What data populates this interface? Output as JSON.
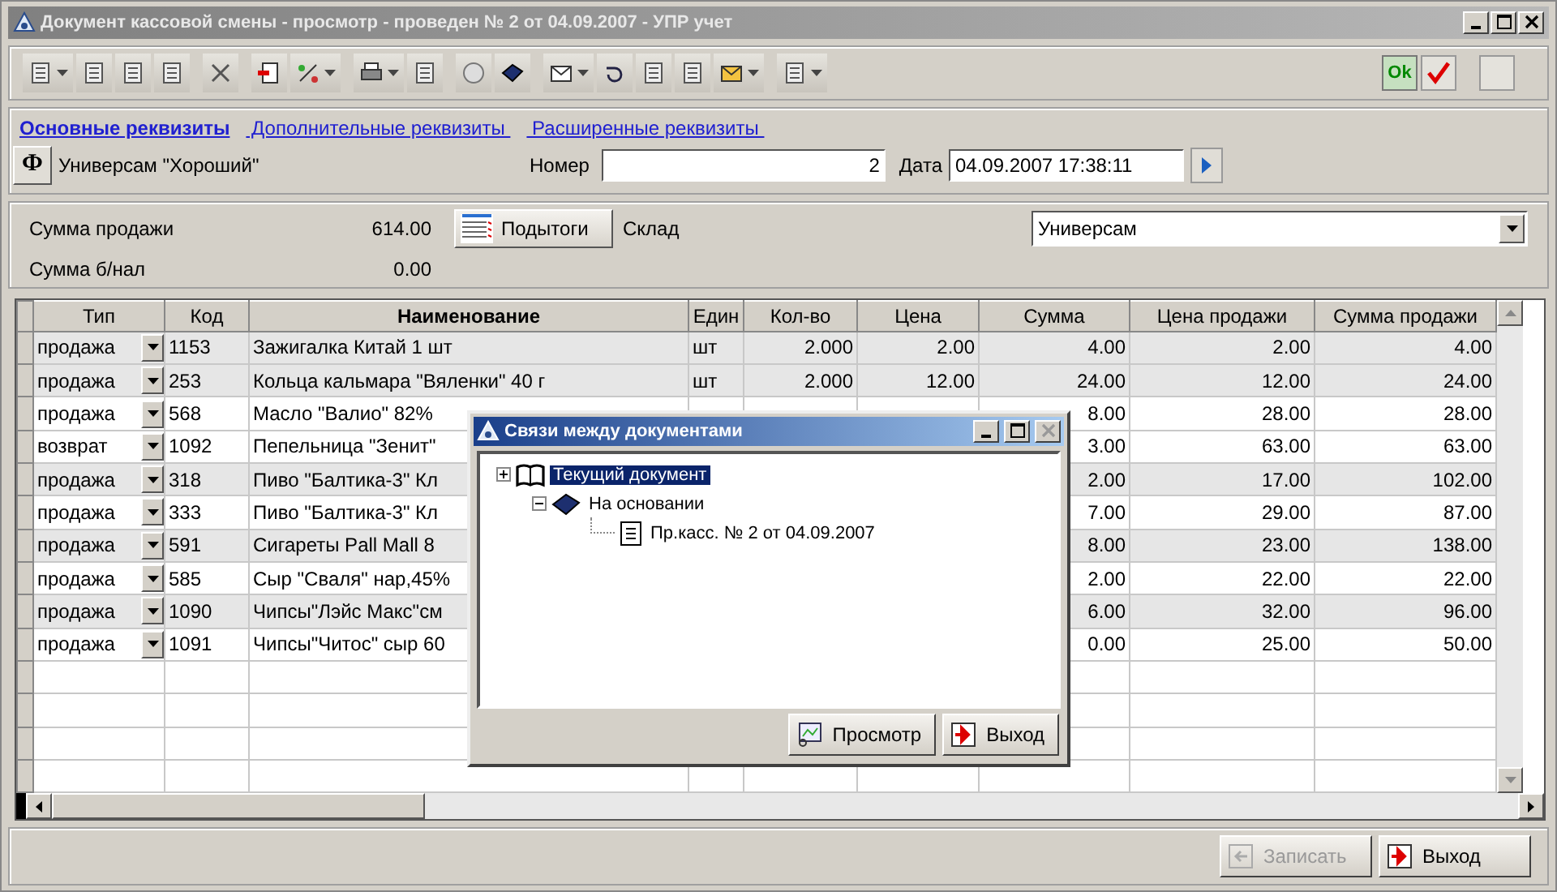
{
  "window": {
    "title": "Документ кассовой смены  - просмотр - проведен № 2 от 04.09.2007 - УПР учет"
  },
  "toolbar_right": {
    "ok_label": "Ok"
  },
  "tabs": [
    {
      "label": "Основные реквизиты",
      "selected": true
    },
    {
      "label": " Дополнительные реквизиты ",
      "selected": false
    },
    {
      "label": " Расширенные реквизиты ",
      "selected": false
    }
  ],
  "header": {
    "firm_button": "Ф",
    "firm_name": "Универсам \"Хороший\"",
    "number_label": "Номер",
    "number": "2",
    "date_label": "Дата",
    "date": "04.09.2007 17:38:11"
  },
  "summary": {
    "sale_label": "Сумма продажи",
    "sale_value": "614.00",
    "card_label": "Сумма б/нал",
    "card_value": "0.00",
    "subtotals_button": "Подытоги",
    "warehouse_label": "Склад",
    "warehouse": "Универсам"
  },
  "table": {
    "columns": [
      "Тип",
      "Код",
      "Наименование",
      "Един",
      "Кол-во",
      "Цена",
      "Сумма",
      "Цена продажи",
      "Сумма продажи"
    ],
    "rows": [
      {
        "shaded": true,
        "type": "продажа",
        "code": "1153",
        "name": "Зажигалка Китай 1 шт",
        "unit": "шт",
        "qty": "2.000",
        "price": "2.00",
        "sum": "4.00",
        "sale_price": "2.00",
        "sale_sum": "4.00"
      },
      {
        "shaded": true,
        "type": "продажа",
        "code": "253",
        "name": "Кольца кальмара \"Вяленки\" 40 г",
        "unit": "шт",
        "qty": "2.000",
        "price": "12.00",
        "sum": "24.00",
        "sale_price": "12.00",
        "sale_sum": "24.00"
      },
      {
        "shaded": false,
        "type": "продажа",
        "code": "568",
        "name": "Масло \"Валио\" 82%",
        "sum": "8.00",
        "sale_price": "28.00",
        "sale_sum": "28.00"
      },
      {
        "shaded": false,
        "type": "возврат",
        "code": "1092",
        "name": "Пепельница \"Зенит\"",
        "sum": "3.00",
        "sale_price": "63.00",
        "sale_sum": "63.00"
      },
      {
        "shaded": true,
        "type": "продажа",
        "code": "318",
        "name": "Пиво \"Балтика-3\" Кл",
        "sum": "2.00",
        "sale_price": "17.00",
        "sale_sum": "102.00"
      },
      {
        "shaded": false,
        "type": "продажа",
        "code": "333",
        "name": "Пиво \"Балтика-3\" Кл",
        "sum": "7.00",
        "sale_price": "29.00",
        "sale_sum": "87.00"
      },
      {
        "shaded": true,
        "type": "продажа",
        "code": "591",
        "name": "Сигареты Pall Mall 8",
        "sum": "8.00",
        "sale_price": "23.00",
        "sale_sum": "138.00"
      },
      {
        "shaded": false,
        "type": "продажа",
        "code": "585",
        "name": "Сыр \"Сваля\" нар,45%",
        "sum": "2.00",
        "sale_price": "22.00",
        "sale_sum": "22.00"
      },
      {
        "shaded": true,
        "type": "продажа",
        "code": "1090",
        "name": "Чипсы\"Лэйс Макс\"см",
        "sum": "6.00",
        "sale_price": "32.00",
        "sale_sum": "96.00"
      },
      {
        "shaded": false,
        "type": "продажа",
        "code": "1091",
        "name": "Чипсы\"Читос\" сыр 60",
        "sum": "0.00",
        "sale_price": "25.00",
        "sale_sum": "50.00"
      }
    ]
  },
  "dialog": {
    "title": "Связи между документами",
    "tree": [
      {
        "label": "Текущий документ",
        "expanded": false,
        "selected": true,
        "children": [
          {
            "label": "На основании",
            "expanded": true,
            "selected": false,
            "children": [
              {
                "label": "Пр.касс. № 2 от 04.09.2007",
                "selected": false
              }
            ]
          }
        ]
      }
    ],
    "buttons": [
      {
        "label": "Просмотр",
        "kind": "view"
      },
      {
        "label": "Выход",
        "kind": "exit"
      }
    ]
  },
  "footer": {
    "buttons": [
      {
        "label": "Записать",
        "kind": "save",
        "disabled": true
      },
      {
        "label": "Выход",
        "kind": "exit",
        "disabled": false
      }
    ]
  }
}
